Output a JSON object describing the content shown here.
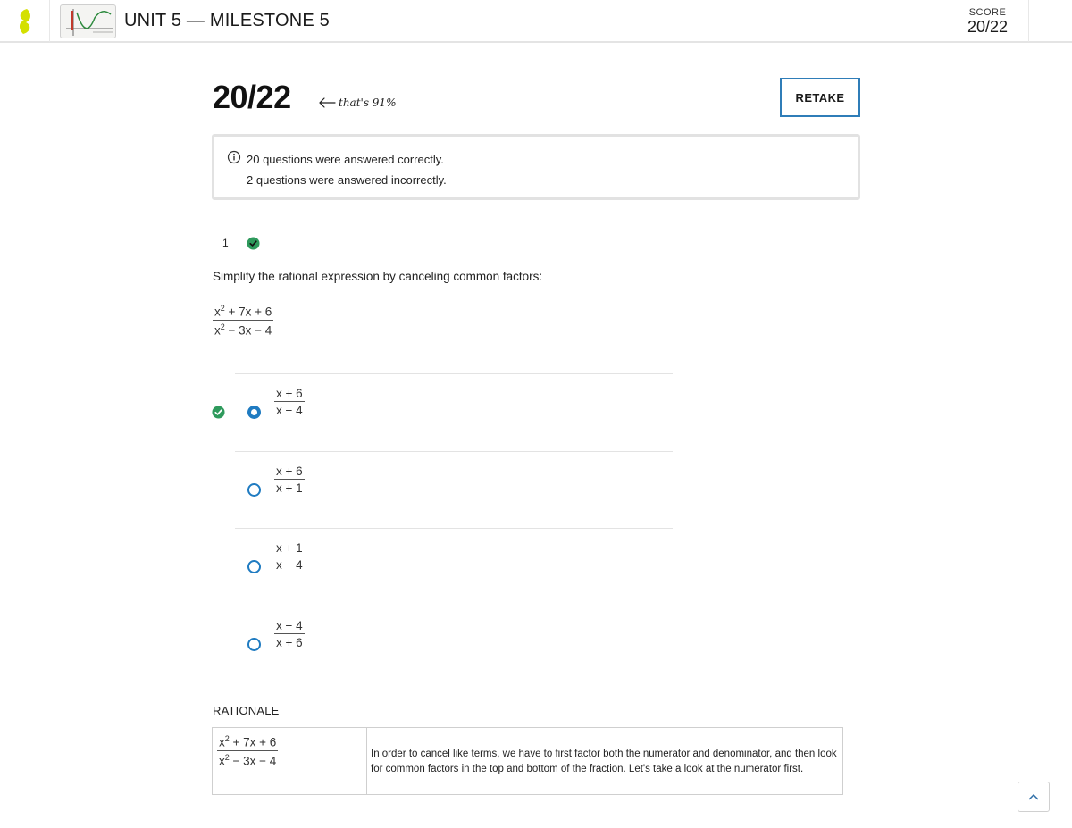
{
  "header": {
    "title": "UNIT 5 — MILESTONE 5",
    "score_label": "SCORE",
    "score_value": "20/22"
  },
  "summary": {
    "score": "20/22",
    "percent_note": "that's 91%",
    "retake_label": "RETAKE",
    "correct_line": "20 questions were answered correctly.",
    "incorrect_line": "2 questions were answered incorrectly."
  },
  "question": {
    "number": "1",
    "prompt": "Simplify the rational expression by canceling common factors:",
    "expression": {
      "num_a": "x",
      "num_exp": "2",
      "num_b": " + 7x + 6",
      "den_a": "x",
      "den_exp": "2",
      "den_b": " − 3x − 4"
    },
    "choices": [
      {
        "num": "x + 6",
        "den": "x − 4",
        "selected": true,
        "correct": true
      },
      {
        "num": "x + 6",
        "den": "x + 1",
        "selected": false,
        "correct": false
      },
      {
        "num": "x + 1",
        "den": "x − 4",
        "selected": false,
        "correct": false
      },
      {
        "num": "x − 4",
        "den": "x + 6",
        "selected": false,
        "correct": false
      }
    ]
  },
  "rationale": {
    "label": "RATIONALE",
    "expression": {
      "num_a": "x",
      "num_exp": "2",
      "num_b": " + 7x + 6",
      "den_a": "x",
      "den_exp": "2",
      "den_b": " − 3x − 4"
    },
    "text": "In order to cancel like terms, we have to first factor both the numerator and denominator, and then look for common factors in the top and bottom of the fraction.  Let's take a look at the numerator first."
  },
  "colors": {
    "brand_yellow": "#d4e000",
    "correct_green": "#2e9a5c",
    "radio_blue": "#1f7bc1",
    "retake_border": "#2f7db8"
  },
  "icons": [
    "logo-icon",
    "info-icon",
    "check-circle-icon",
    "arrow-left-icon",
    "chevron-up-icon"
  ]
}
